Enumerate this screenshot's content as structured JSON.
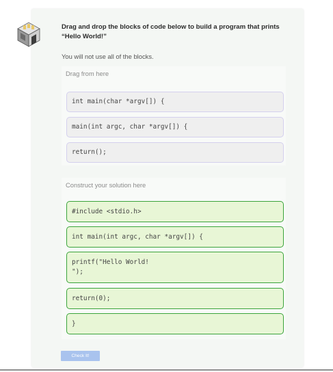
{
  "question": {
    "title": "Drag and drop the blocks of code below to build a program that prints “Hello World!”",
    "note": "You will not use all of the blocks."
  },
  "source_zone": {
    "label": "Drag from here",
    "blocks": [
      "int main(char *argv[]) {",
      "main(int argc, char *argv[]) {",
      "return();"
    ]
  },
  "target_zone": {
    "label": "Construct your solution here",
    "blocks": [
      "#include <stdio.h>",
      "int main(int argc, char *argv[]) {",
      "printf(\"Hello World!\n\");",
      "return(0);",
      "}"
    ]
  },
  "check_button": {
    "label": "Check It!"
  },
  "colors": {
    "card_background": "#f4f7f4",
    "source_block_border": "#d4d0ee",
    "target_block_fill": "#e8f6d6",
    "target_block_border": "#3ba43b",
    "button": "#a9c3ee"
  },
  "icons": {
    "avatar": "isometric-room-icon"
  }
}
